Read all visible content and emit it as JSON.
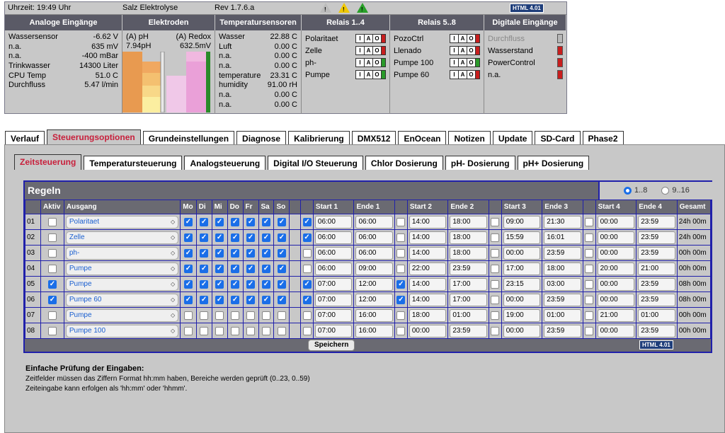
{
  "topbar": {
    "time": "Uhrzeit: 19:49 Uhr",
    "system": "Salz Elektrolyse",
    "rev": "Rev 1.7.6.a",
    "badge": "HTML 4.01"
  },
  "heads": [
    "Analoge Eingänge",
    "Elektroden",
    "Temperatursensoren",
    "Relais 1..4",
    "Relais 5..8",
    "Digitale Eingänge"
  ],
  "analog": [
    [
      "Wassersensor",
      "-6.62 V"
    ],
    [
      "n.a.",
      "635 mV"
    ],
    [
      "n.a.",
      "-400 mBar"
    ],
    [
      "Trinkwasser",
      "14300 Liter"
    ],
    [
      "CPU Temp",
      "51.0 C"
    ],
    [
      "Durchfluss",
      "5.47 l/min"
    ]
  ],
  "electrodes": {
    "ph_label": "(A) pH",
    "redox_label": "(A) Redox",
    "ph_value": "7.94pH",
    "redox_value": "632.5mV"
  },
  "temps": [
    [
      "Wasser",
      "22.88 C"
    ],
    [
      "Luft",
      "0.00 C"
    ],
    [
      "n.a.",
      "0.00 C"
    ],
    [
      "n.a.",
      "0.00 C"
    ],
    [
      "temperature",
      "23.31 C"
    ],
    [
      "humidity",
      "91.00 rH"
    ],
    [
      "n.a.",
      "0.00 C"
    ],
    [
      "n.a.",
      "0.00 C"
    ]
  ],
  "relais1": [
    {
      "name": "Polaritaet",
      "state": "r"
    },
    {
      "name": "Zelle",
      "state": "r"
    },
    {
      "name": "ph-",
      "state": "g"
    },
    {
      "name": "Pumpe",
      "state": "g"
    }
  ],
  "relais2": [
    {
      "name": "PozoCtrl",
      "state": "r"
    },
    {
      "name": "Llenado",
      "state": "r"
    },
    {
      "name": "Pumpe 100",
      "state": "g"
    },
    {
      "name": "Pumpe 60",
      "state": "r"
    }
  ],
  "relay_letters": {
    "i": "I",
    "a": "A",
    "o": "O"
  },
  "digital": [
    {
      "name": "Durchfluss",
      "state": "gr"
    },
    {
      "name": "Wasserstand",
      "state": "rd"
    },
    {
      "name": "PowerControl",
      "state": "rd"
    },
    {
      "name": "n.a.",
      "state": "rd"
    }
  ],
  "main_tabs": [
    "Verlauf",
    "Steuerungsoptionen",
    "Grundeinstellungen",
    "Diagnose",
    "Kalibrierung",
    "DMX512",
    "EnOcean",
    "Notizen",
    "Update",
    "SD-Card",
    "Phase2"
  ],
  "sub_tabs": [
    "Zeitsteuerung",
    "Temperatursteuerung",
    "Analogsteuerung",
    "Digital I/O Steuerung",
    "Chlor Dosierung",
    "pH- Dosierung",
    "pH+ Dosierung"
  ],
  "rules": {
    "title": "Regeln",
    "range1": "1..8",
    "range2": "9..16",
    "save": "Speichern",
    "badge": "HTML 4.01",
    "headers": [
      "",
      "Aktiv",
      "Ausgang",
      "Mo",
      "Di",
      "Mi",
      "Do",
      "Fr",
      "Sa",
      "So",
      "",
      "",
      "Start 1",
      "Ende 1",
      "",
      "Start 2",
      "Ende 2",
      "",
      "Start 3",
      "Ende 3",
      "",
      "Start 4",
      "Ende 4",
      "Gesamt"
    ],
    "rows": [
      {
        "no": "01",
        "aktiv": false,
        "out": "Polaritaet",
        "days": [
          1,
          1,
          1,
          1,
          1,
          1,
          1
        ],
        "e1": 1,
        "s1": "06:00",
        "n1": "06:00",
        "e2": 0,
        "s2": "14:00",
        "n2": "18:00",
        "e3": 0,
        "s3": "09:00",
        "n3": "21:30",
        "e4": 0,
        "s4": "00:00",
        "n4": "23:59",
        "tot": "24h 00m"
      },
      {
        "no": "02",
        "aktiv": false,
        "out": "Zelle",
        "days": [
          1,
          1,
          1,
          1,
          1,
          1,
          1
        ],
        "e1": 1,
        "s1": "06:00",
        "n1": "06:00",
        "e2": 0,
        "s2": "14:00",
        "n2": "18:00",
        "e3": 0,
        "s3": "15:59",
        "n3": "16:01",
        "e4": 0,
        "s4": "00:00",
        "n4": "23:59",
        "tot": "24h 00m"
      },
      {
        "no": "03",
        "aktiv": false,
        "out": "ph-",
        "days": [
          1,
          1,
          1,
          1,
          1,
          1,
          1
        ],
        "e1": 0,
        "s1": "06:00",
        "n1": "06:00",
        "e2": 0,
        "s2": "14:00",
        "n2": "18:00",
        "e3": 0,
        "s3": "00:00",
        "n3": "23:59",
        "e4": 0,
        "s4": "00:00",
        "n4": "23:59",
        "tot": "00h 00m"
      },
      {
        "no": "04",
        "aktiv": false,
        "out": "Pumpe",
        "days": [
          1,
          1,
          1,
          1,
          1,
          1,
          1
        ],
        "e1": 0,
        "s1": "06:00",
        "n1": "09:00",
        "e2": 0,
        "s2": "22:00",
        "n2": "23:59",
        "e3": 0,
        "s3": "17:00",
        "n3": "18:00",
        "e4": 0,
        "s4": "20:00",
        "n4": "21:00",
        "tot": "00h 00m"
      },
      {
        "no": "05",
        "aktiv": true,
        "out": "Pumpe",
        "days": [
          1,
          1,
          1,
          1,
          1,
          1,
          1
        ],
        "e1": 1,
        "s1": "07:00",
        "n1": "12:00",
        "e2": 1,
        "s2": "14:00",
        "n2": "17:00",
        "e3": 0,
        "s3": "23:15",
        "n3": "03:00",
        "e4": 0,
        "s4": "00:00",
        "n4": "23:59",
        "tot": "08h 00m"
      },
      {
        "no": "06",
        "aktiv": true,
        "out": "Pumpe 60",
        "days": [
          1,
          1,
          1,
          1,
          1,
          1,
          1
        ],
        "e1": 1,
        "s1": "07:00",
        "n1": "12:00",
        "e2": 1,
        "s2": "14:00",
        "n2": "17:00",
        "e3": 0,
        "s3": "00:00",
        "n3": "23:59",
        "e4": 0,
        "s4": "00:00",
        "n4": "23:59",
        "tot": "08h 00m"
      },
      {
        "no": "07",
        "aktiv": false,
        "out": "Pumpe",
        "days": [
          0,
          0,
          0,
          0,
          0,
          0,
          0
        ],
        "e1": 0,
        "s1": "07:00",
        "n1": "16:00",
        "e2": 0,
        "s2": "18:00",
        "n2": "01:00",
        "e3": 0,
        "s3": "19:00",
        "n3": "01:00",
        "e4": 0,
        "s4": "21:00",
        "n4": "01:00",
        "tot": "00h 00m"
      },
      {
        "no": "08",
        "aktiv": false,
        "out": "Pumpe 100",
        "days": [
          0,
          0,
          0,
          0,
          0,
          0,
          0
        ],
        "e1": 0,
        "s1": "07:00",
        "n1": "16:00",
        "e2": 0,
        "s2": "00:00",
        "n2": "23:59",
        "e3": 0,
        "s3": "00:00",
        "n3": "23:59",
        "e4": 0,
        "s4": "00:00",
        "n4": "23:59",
        "tot": "00h 00m"
      }
    ]
  },
  "help": {
    "title": "Einfache Prüfung der Eingaben:",
    "line1": "Zeitfelder müssen das Ziffern Format hh:mm haben, Bereiche werden geprüft (0..23, 0..59)",
    "line2": "Zeiteingabe kann erfolgen als 'hh:mm' oder 'hhmm'."
  }
}
